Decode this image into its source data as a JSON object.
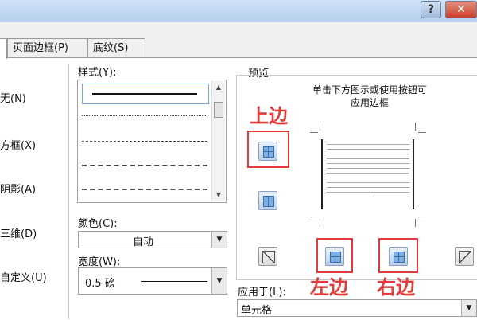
{
  "titlebar": {
    "help_label": "?",
    "close_label": "✕"
  },
  "tabs": [
    "页面边框(P)",
    "底纹(S)"
  ],
  "setting": {
    "items": [
      "无(N)",
      "方框(X)",
      "阴影(A)",
      "三维(D)",
      "自定义(U)"
    ]
  },
  "style": {
    "label": "样式(Y):"
  },
  "color": {
    "label": "颜色(C):",
    "value": "自动"
  },
  "width": {
    "label": "宽度(W):",
    "value": "0.5 磅"
  },
  "preview": {
    "label": "预览",
    "hint_line1": "单击下方图示或使用按钮可",
    "hint_line2": "应用边框"
  },
  "annotations": {
    "top": "上边",
    "left": "左边",
    "right": "右边"
  },
  "apply_to": {
    "label": "应用于(L):",
    "value": "单元格"
  },
  "accent_color": "#e23b3b"
}
